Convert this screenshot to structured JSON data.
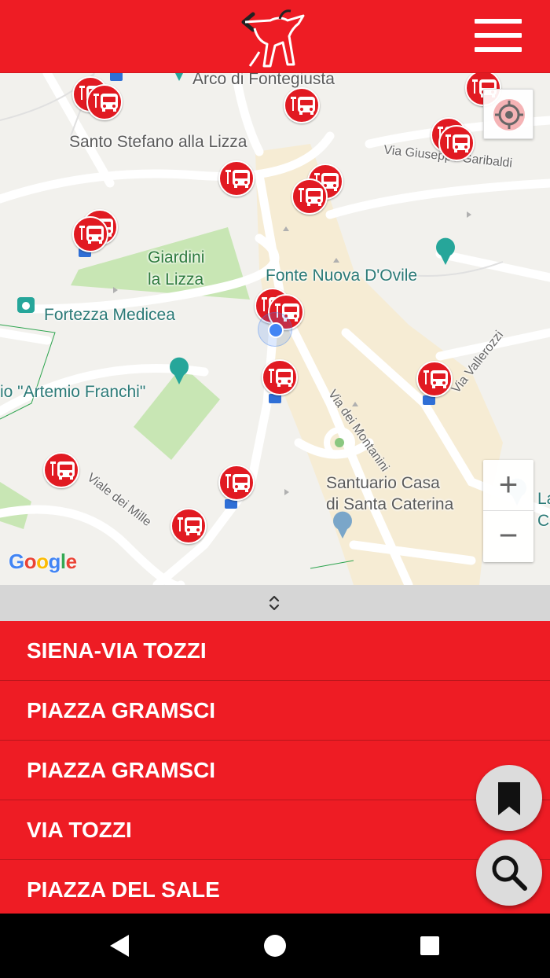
{
  "colors": {
    "brand_red": "#ee1c24",
    "handle_gray": "#d6d6d6",
    "location_blue": "#4285f4"
  },
  "map": {
    "labels": {
      "arco": "Arco di Fontegiusta",
      "santo_stefano": "Santo Stefano alla Lizza",
      "garibaldi": "Via Giuseppe Garibaldi",
      "giardini_1": "Giardini",
      "giardini_2": "la Lizza",
      "fonte_nuova": "Fonte Nuova D'Ovile",
      "fortezza": "Fortezza Medicea",
      "stadio": "io \"Artemio Franchi\"",
      "montanini": "Via dei Montanini",
      "vallerozzi": "Via Vallerozzi",
      "santuario_1": "Santuario Casa",
      "santuario_2": "di Santa Caterina",
      "mille": "Viale dei Mille",
      "edge_1": "La",
      "edge_2": "C"
    },
    "google_logo": "Google",
    "zoom_in": "+",
    "zoom_out": "−",
    "icons": {
      "stop": "bus-stop-icon",
      "locate": "locate-me-icon",
      "handle": "chevron-up-down-icon"
    }
  },
  "stops": [
    {
      "name": "SIENA-VIA TOZZI"
    },
    {
      "name": "PIAZZA GRAMSCI"
    },
    {
      "name": "PIAZZA GRAMSCI"
    },
    {
      "name": "VIA TOZZI"
    },
    {
      "name": "PIAZZA DEL SALE"
    }
  ],
  "fabs": {
    "bookmark": "bookmark-icon",
    "search": "search-icon"
  },
  "nav": {
    "back": "back-icon",
    "home": "home-icon",
    "recents": "recents-icon"
  }
}
